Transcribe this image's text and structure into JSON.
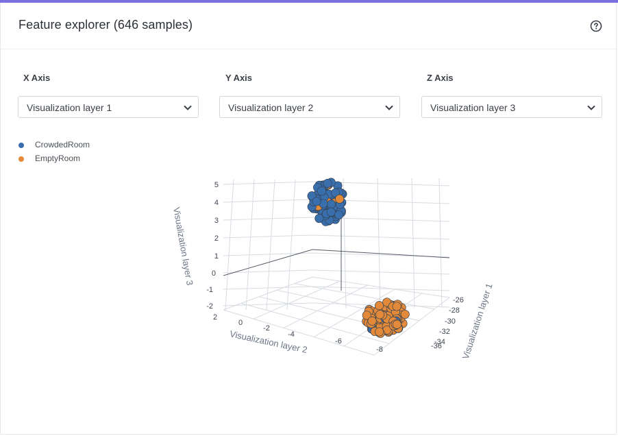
{
  "header": {
    "title": "Feature explorer (646 samples)"
  },
  "controls": [
    {
      "label": "X Axis",
      "value": "Visualization layer 1"
    },
    {
      "label": "Y Axis",
      "value": "Visualization layer 2"
    },
    {
      "label": "Z Axis",
      "value": "Visualization layer 3"
    }
  ],
  "legend": [
    {
      "name": "CrowdedRoom",
      "color": "#3a6fae"
    },
    {
      "name": "EmptyRoom",
      "color": "#e38a3a"
    }
  ],
  "chart_data": {
    "type": "scatter",
    "title": "",
    "axes": {
      "x": {
        "label": "Visualization layer 1",
        "ticks": [
          "-26",
          "-28",
          "-30",
          "-32",
          "-34",
          "-36"
        ]
      },
      "y": {
        "label": "Visualization layer 2",
        "ticks": [
          "2",
          "0",
          "-2",
          "-4",
          "-6",
          "-8"
        ]
      },
      "z": {
        "label": "Visualization layer 3",
        "ticks": [
          "5",
          "4",
          "3",
          "2",
          "1",
          "0",
          "-1",
          "-2"
        ]
      }
    },
    "series": [
      {
        "name": "CrowdedRoom",
        "color": "#3a6fae",
        "cluster_center": {
          "x": -29,
          "y": -5,
          "z": 4
        }
      },
      {
        "name": "EmptyRoom",
        "color": "#e38a3a",
        "cluster_center": {
          "x": -32,
          "y": -7,
          "z": -1.5
        }
      }
    ],
    "grid": true,
    "legend_position": "top-left"
  }
}
